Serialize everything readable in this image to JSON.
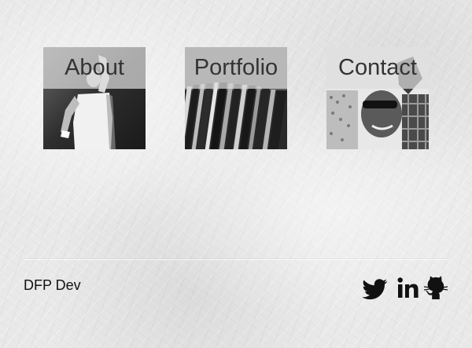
{
  "nav": {
    "tiles": [
      {
        "label": "About"
      },
      {
        "label": "Portfolio"
      },
      {
        "label": "Contact"
      }
    ]
  },
  "footer": {
    "brand": "DFP Dev",
    "social": [
      {
        "icon": "twitter-bird-icon"
      },
      {
        "icon": "linkedin-in-icon"
      },
      {
        "icon": "github-octocat-icon"
      }
    ]
  },
  "colors": {
    "paper": "#e9e9e9",
    "label_text": "#333333",
    "icon": "#111111"
  }
}
